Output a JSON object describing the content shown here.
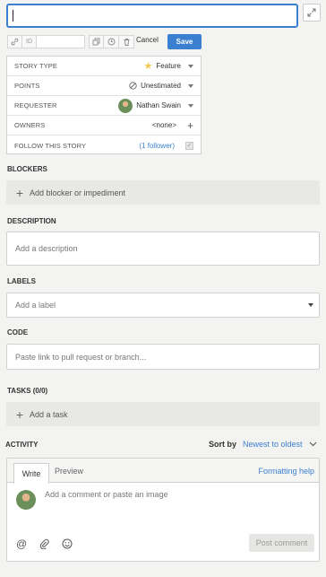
{
  "header": {
    "id_label": "ID",
    "cancel_label": "Cancel",
    "save_label": "Save"
  },
  "properties": {
    "story_type": {
      "label": "STORY TYPE",
      "value": "Feature"
    },
    "points": {
      "label": "POINTS",
      "value": "Unestimated"
    },
    "requester": {
      "label": "REQUESTER",
      "value": "Nathan Swain"
    },
    "owners": {
      "label": "OWNERS",
      "value": "<none>"
    },
    "follow": {
      "label": "FOLLOW THIS STORY",
      "value": "(1 follower)"
    }
  },
  "blockers": {
    "heading": "BLOCKERS",
    "add_label": "Add blocker or impediment"
  },
  "description": {
    "heading": "DESCRIPTION",
    "placeholder": "Add a description"
  },
  "labels": {
    "heading": "LABELS",
    "placeholder": "Add a label"
  },
  "code": {
    "heading": "CODE",
    "placeholder": "Paste link to pull request or branch..."
  },
  "tasks": {
    "heading": "TASKS (0/0)",
    "add_label": "Add a task"
  },
  "activity": {
    "heading": "ACTIVITY",
    "sort_label": "Sort by",
    "sort_value": "Newest to oldest",
    "tabs": [
      "Write",
      "Preview"
    ],
    "formatting_help": "Formatting help",
    "comment_placeholder": "Add a comment or paste an image",
    "post_label": "Post comment"
  },
  "colors": {
    "accent": "#3a7fd0",
    "star": "#f2c94c"
  }
}
